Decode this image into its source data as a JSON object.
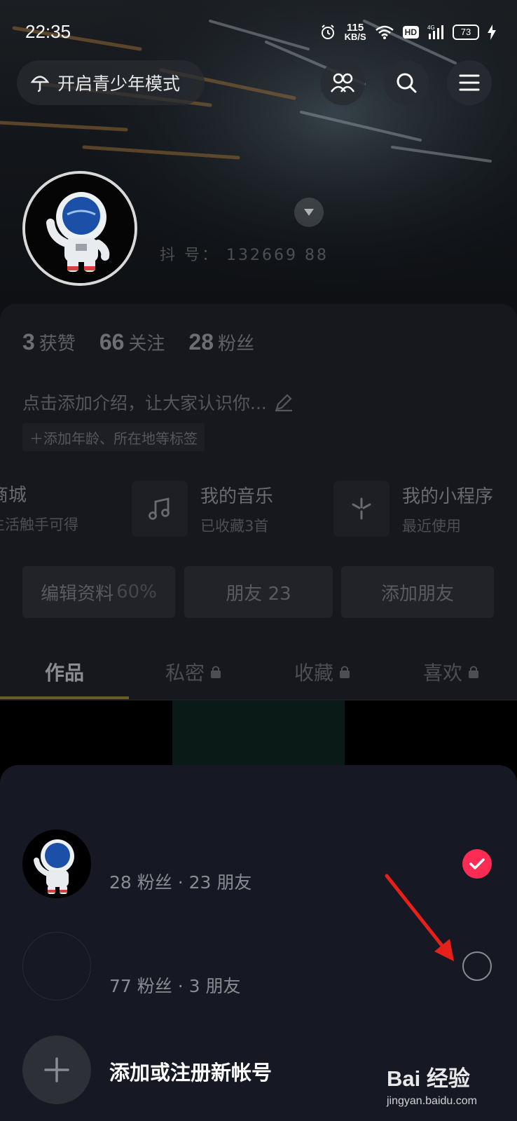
{
  "status_bar": {
    "time": "22:35",
    "speed_value": "115",
    "speed_unit": "KB/S",
    "hd": "HD",
    "network": "4G",
    "battery": "73"
  },
  "header": {
    "teen_mode_label": "开启青少年模式"
  },
  "profile": {
    "user_id_masked": "抖  号：    132669 88"
  },
  "stats": [
    {
      "value": "3",
      "label": "获赞"
    },
    {
      "value": "66",
      "label": "关注"
    },
    {
      "value": "28",
      "label": "粉丝"
    }
  ],
  "bio": {
    "prompt": "点击添加介绍，让大家认识你...",
    "tag_button": "＋添加年龄、所在地等标签"
  },
  "services": [
    {
      "title": "商城",
      "subtitle": "生活触手可得",
      "icon": "shop-icon"
    },
    {
      "title": "我的音乐",
      "subtitle": "已收藏3首",
      "icon": "music-note-icon"
    },
    {
      "title": "我的小程序",
      "subtitle": "最近使用",
      "icon": "mini-program-icon"
    }
  ],
  "actions": {
    "edit_profile": "编辑资料",
    "edit_progress": "60%",
    "friends": "朋友 23",
    "add_friend": "添加朋友"
  },
  "tabs": [
    {
      "label": "作品",
      "locked": false
    },
    {
      "label": "私密",
      "locked": true
    },
    {
      "label": "收藏",
      "locked": true
    },
    {
      "label": "喜欢",
      "locked": true
    }
  ],
  "account_sheet": {
    "accounts": [
      {
        "meta": "28 粉丝 · 23 朋友",
        "selected": true
      },
      {
        "meta": "77 粉丝 · 3 朋友",
        "selected": false
      }
    ],
    "add_account_label": "添加或注册新帐号"
  },
  "watermark": {
    "logo_text": "Bai 经验",
    "url": "jingyan.baidu.com"
  },
  "colors": {
    "accent": "#fe2c55",
    "sheet_bg": "#161823",
    "panel_bg": "#17181d",
    "arrow": "#e8201a"
  }
}
